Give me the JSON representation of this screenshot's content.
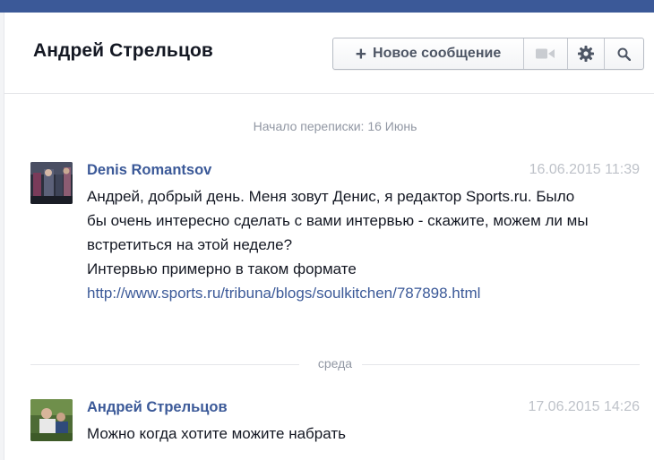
{
  "header": {
    "title": "Андрей Стрельцов",
    "new_message_label": "Новое сообщение",
    "plus_icon": "+"
  },
  "conversation_start": "Начало переписки: 16 Июнь",
  "messages": [
    {
      "sender": "Denis Romantsov",
      "time": "16.06.2015 11:39",
      "text": "Андрей, добрый день. Меня зовут Денис, я редактор Sports.ru. Было бы очень интересно сделать с вами интервью - скажите, можем ли мы встретиться на этой неделе?",
      "text2": "Интервью примерно в таком формате ",
      "link": "http://www.sports.ru/tribuna/blogs/soulkitchen/787898.html"
    },
    {
      "sender": "Андрей Стрельцов",
      "time": "17.06.2015 14:26",
      "text": "Можно когда хотите можите набрать"
    }
  ],
  "day_separator": "среда",
  "colors": {
    "brand_bar": "#3b5998",
    "link": "#3b5998",
    "timestamp": "#bec2c9",
    "muted": "#9197a3"
  },
  "icons": [
    "plus-icon",
    "video-camera-icon",
    "gear-icon",
    "search-icon"
  ]
}
